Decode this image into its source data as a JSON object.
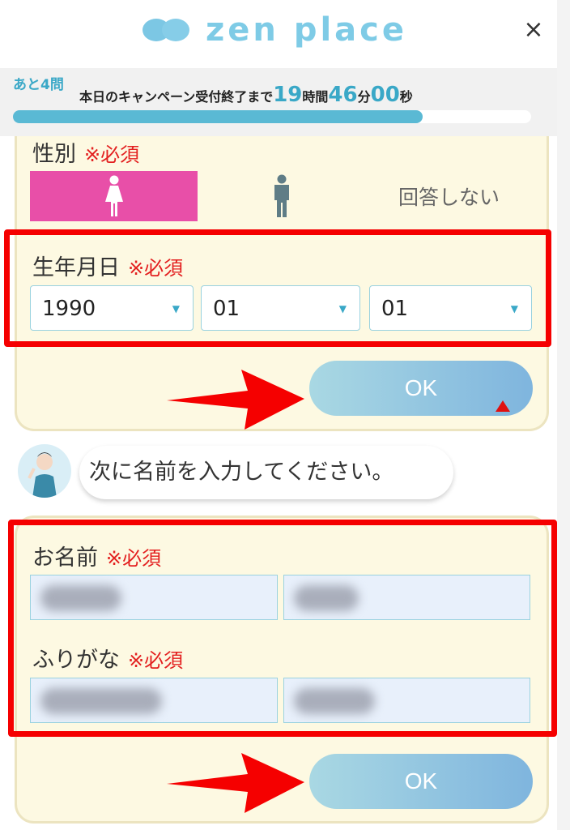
{
  "header": {
    "logo_text": "zen place",
    "close_glyph": "×"
  },
  "progress": {
    "remaining_label": "あと4問",
    "countdown_prefix": "本日のキャンペーン受付終了まで",
    "hours": "19",
    "hours_unit": "時間",
    "minutes": "46",
    "minutes_unit": "分",
    "seconds": "00",
    "seconds_unit": "秒",
    "fill_percent": 79
  },
  "gender": {
    "label": "性別",
    "required": "※必須",
    "options": [
      "female-icon",
      "male-icon"
    ],
    "none_label": "回答しない",
    "selected": "female"
  },
  "birthdate": {
    "label": "生年月日",
    "required": "※必須",
    "year": "1990",
    "month": "01",
    "day": "01"
  },
  "buttons": {
    "ok_1": "OK",
    "ok_2": "OK"
  },
  "chat": {
    "message": "次に名前を入力してください。"
  },
  "name_section": {
    "name_label": "お名前",
    "name_required": "※必須",
    "kana_label": "ふりがな",
    "kana_required": "※必須"
  },
  "colors": {
    "accent": "#3aa8c7",
    "female_selected": "#e84fa8",
    "required_red": "#e32020",
    "highlight_red": "#f50000",
    "card_bg": "#fdf9e2"
  }
}
